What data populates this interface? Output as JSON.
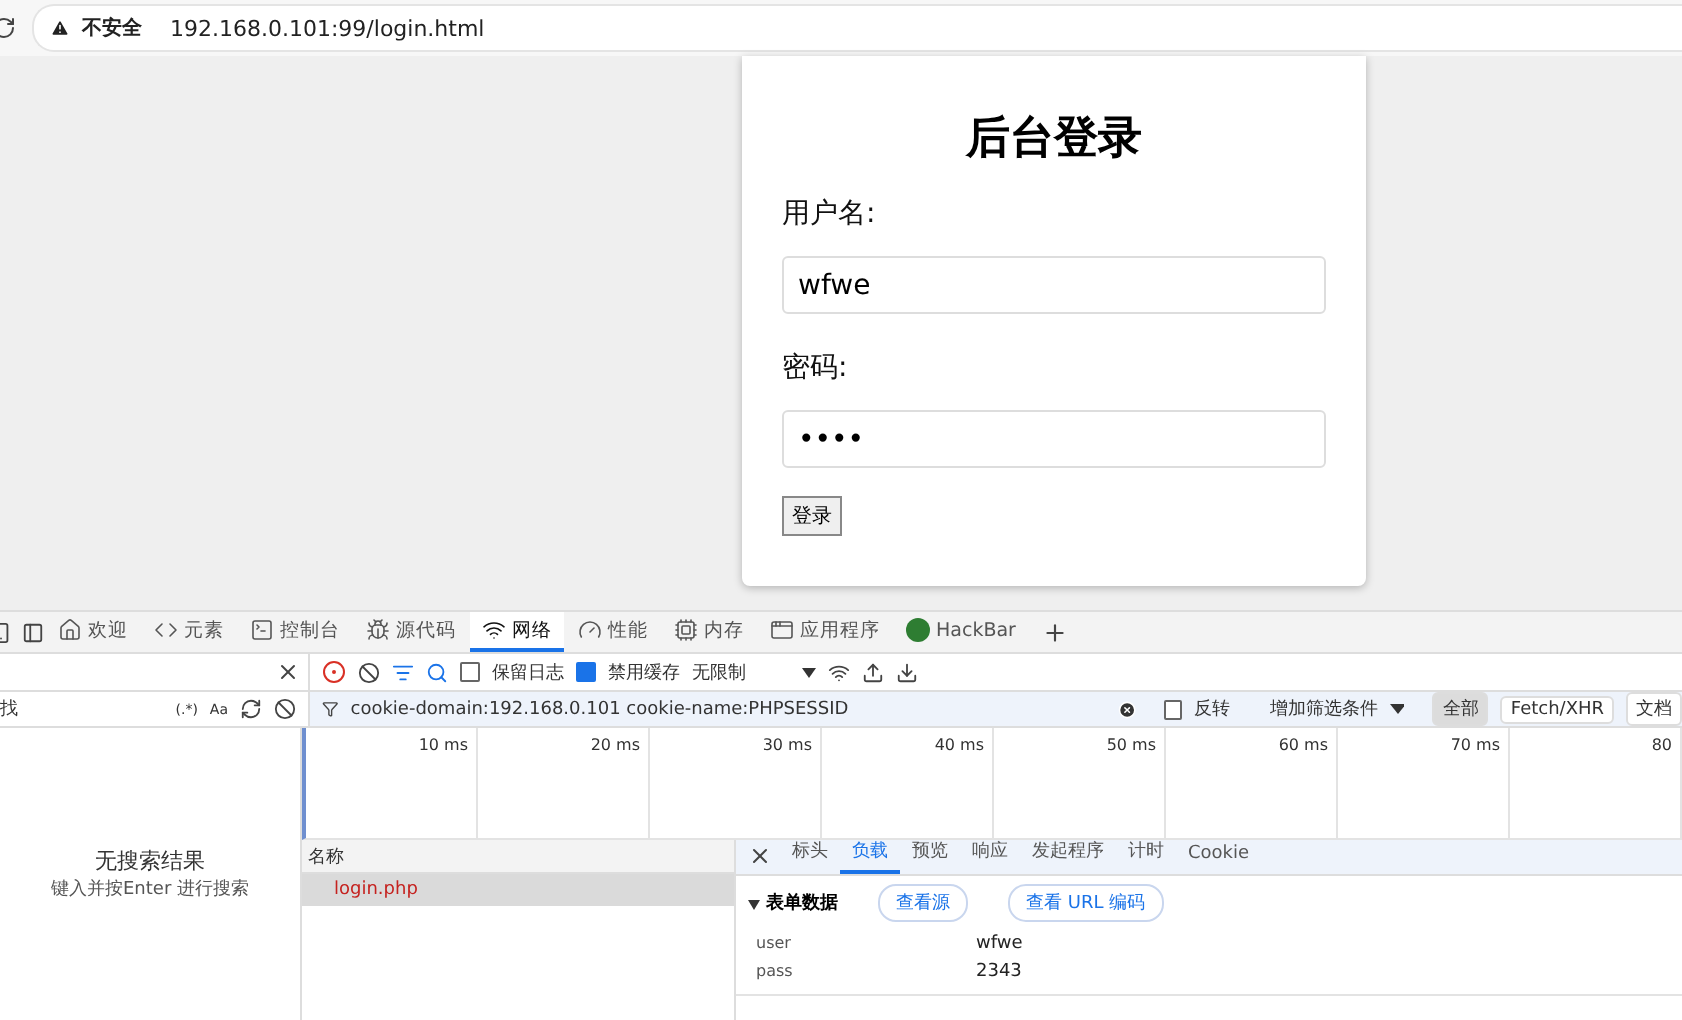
{
  "address_bar": {
    "security_label": "不安全",
    "url": "192.168.0.101:99/login.html"
  },
  "login": {
    "title": "后台登录",
    "fields": [
      {
        "label": "用户名:",
        "value": "wfwe"
      },
      {
        "label": "密码:",
        "value": "••••"
      }
    ],
    "button": "登录"
  },
  "devtools": {
    "tabs": [
      {
        "label": "欢迎",
        "selected": false
      },
      {
        "label": "元素",
        "selected": false
      },
      {
        "label": "控制台",
        "selected": false
      },
      {
        "label": "源代码",
        "selected": false
      },
      {
        "label": "网络",
        "selected": true
      },
      {
        "label": "性能",
        "selected": false
      },
      {
        "label": "内存",
        "selected": false
      },
      {
        "label": "应用程序",
        "selected": false
      },
      {
        "label": "HackBar",
        "selected": false
      }
    ],
    "search_panel": {
      "placeholder": "找",
      "regex": "(.*)",
      "case": "Aa",
      "empty_title": "无搜索结果",
      "empty_hint": "键入并按Enter 进行搜索"
    },
    "network_toolbar": {
      "checkboxes": [
        {
          "label": "保留日志",
          "checked": false
        },
        {
          "label": "禁用缓存",
          "checked": true
        }
      ],
      "throttling": "无限制"
    },
    "filter_bar": {
      "value": "cookie-domain:192.168.0.101 cookie-name:PHPSESSID",
      "invert": {
        "label": "反转",
        "checked": false
      },
      "more_filters": "增加筛选条件",
      "types": [
        {
          "label": "全部",
          "selected": true
        },
        {
          "label": "Fetch/XHR",
          "selected": false
        },
        {
          "label": "文档",
          "selected": false
        }
      ]
    },
    "timeline": {
      "ticks": [
        "10 ms",
        "20 ms",
        "30 ms",
        "40 ms",
        "50 ms",
        "60 ms",
        "70 ms",
        "80"
      ]
    },
    "requests": {
      "header": "名称",
      "rows": [
        {
          "name": "login.php",
          "selected": true
        }
      ]
    },
    "detail": {
      "tabs": [
        {
          "label": "标头",
          "selected": false
        },
        {
          "label": "负载",
          "selected": true
        },
        {
          "label": "预览",
          "selected": false
        },
        {
          "label": "响应",
          "selected": false
        },
        {
          "label": "发起程序",
          "selected": false
        },
        {
          "label": "计时",
          "selected": false
        },
        {
          "label": "Cookie",
          "selected": false
        }
      ],
      "section": {
        "title": "表单数据",
        "expanded": true,
        "buttons": [
          "查看源",
          "查看 URL 编码"
        ],
        "fields": [
          {
            "key": "user",
            "value": "wfwe"
          },
          {
            "key": "pass",
            "value": "2343"
          }
        ]
      }
    }
  }
}
